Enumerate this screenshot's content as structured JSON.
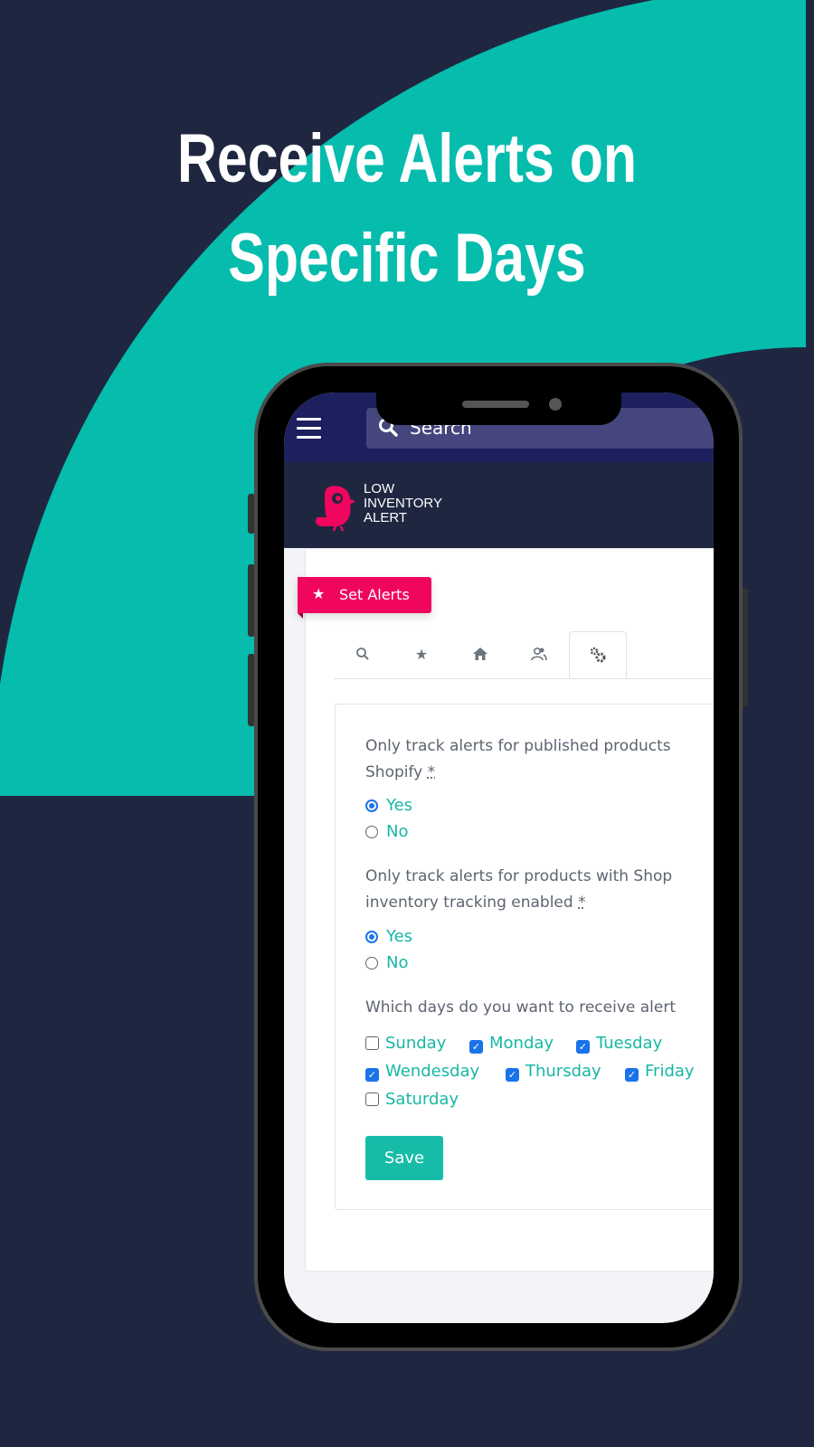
{
  "headline": {
    "line1": "Receive Alerts on",
    "line2": "Specific Days"
  },
  "colors": {
    "background": "#1f2740",
    "accent_teal": "#05bcad",
    "brand_pink": "#f0055f",
    "topbar": "#1d205e",
    "checkbox_blue": "#1a73e8"
  },
  "topbar": {
    "menu_icon": "hamburger-icon",
    "search_icon": "search-icon",
    "search_placeholder": "Search"
  },
  "logo": {
    "line1": "LOW",
    "line2": "INVENTORY",
    "line3": "ALERT"
  },
  "ribbon": {
    "icon": "star-icon",
    "label": "Set Alerts"
  },
  "tabs": [
    {
      "icon": "search-icon",
      "glyph": "⚲",
      "active": false
    },
    {
      "icon": "star-icon",
      "glyph": "★",
      "active": false
    },
    {
      "icon": "home-icon",
      "glyph": "⌂",
      "active": false
    },
    {
      "icon": "users-icon",
      "glyph": "👥",
      "active": false
    },
    {
      "icon": "gears-icon",
      "glyph": "⚙",
      "active": true
    }
  ],
  "form": {
    "q1": {
      "line1": "Only track alerts for published products",
      "line2": "Shopify",
      "required": "*",
      "options": [
        "Yes",
        "No"
      ],
      "selected": "Yes"
    },
    "q2": {
      "line1": "Only track alerts for products with Shop",
      "line2": "inventory tracking enabled",
      "required": "*",
      "options": [
        "Yes",
        "No"
      ],
      "selected": "Yes"
    },
    "q3": {
      "label": "Which days do you want to receive alert"
    },
    "days": [
      {
        "label": "Sunday",
        "checked": false
      },
      {
        "label": "Monday",
        "checked": true
      },
      {
        "label": "Tuesday",
        "checked": true
      },
      {
        "label": "Wendesday",
        "checked": true
      },
      {
        "label": "Thursday",
        "checked": true
      },
      {
        "label": "Friday",
        "checked": true
      },
      {
        "label": "Saturday",
        "checked": false
      }
    ],
    "save_label": "Save"
  }
}
